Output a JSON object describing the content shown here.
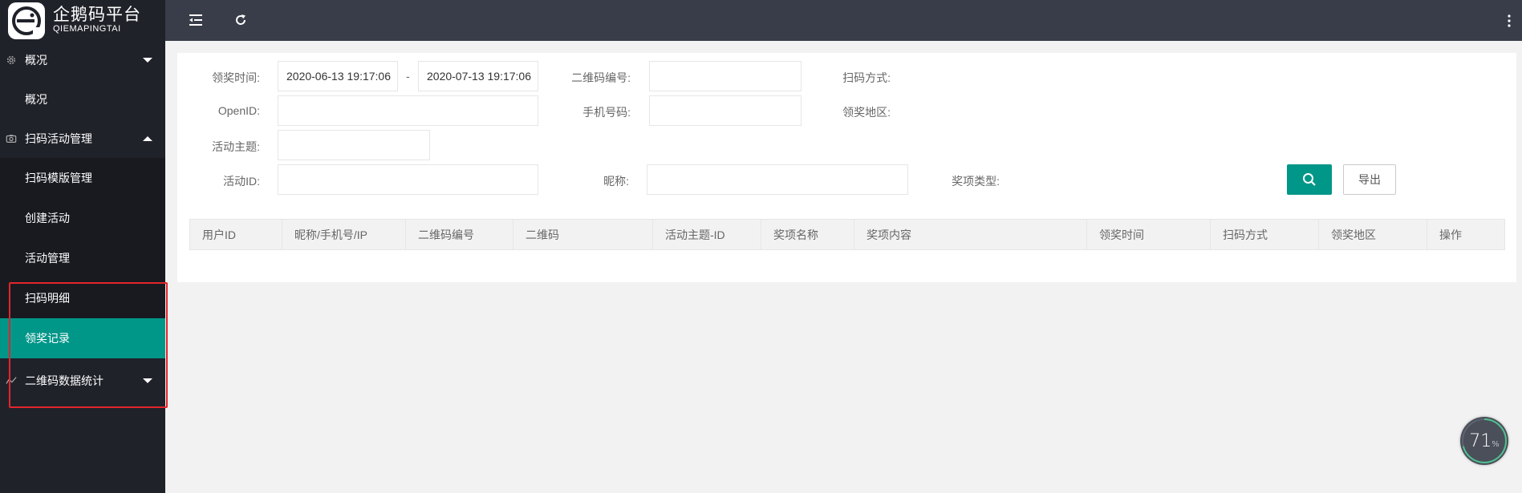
{
  "brand": {
    "name_cn": "企鹅码平台",
    "name_en": "QIEMAPINGTAI"
  },
  "sidebar": {
    "groups": [
      {
        "label": "概况",
        "icon": "gear-icon",
        "expanded": true
      },
      {
        "label": "扫码活动管理",
        "icon": "camera-icon",
        "expanded": true
      },
      {
        "label": "二维码数据统计",
        "icon": "chart-icon",
        "expanded": false
      }
    ],
    "items": [
      {
        "label": "概况"
      },
      {
        "label": "扫码模版管理"
      },
      {
        "label": "创建活动"
      },
      {
        "label": "活动管理"
      },
      {
        "label": "扫码明细"
      },
      {
        "label": "领奖记录",
        "active": true
      }
    ]
  },
  "topbar": {
    "menu_icon": "menu-fold-icon",
    "refresh_icon": "refresh-icon",
    "more_icon": "more-vertical-icon"
  },
  "filters": {
    "award_time_label": "领奖时间:",
    "award_time_start": "2020-06-13 19:17:06",
    "award_time_sep": "-",
    "award_time_end": "2020-07-13 19:17:06",
    "qrcode_no_label": "二维码编号:",
    "qrcode_no_value": "",
    "scan_mode_label": "扫码方式:",
    "openid_label": "OpenID:",
    "openid_value": "",
    "phone_label": "手机号码:",
    "phone_value": "",
    "award_region_label": "领奖地区:",
    "theme_label": "活动主题:",
    "theme_value": "",
    "activity_id_label": "活动ID:",
    "activity_id_value": "",
    "nickname_label": "昵称:",
    "nickname_value": "",
    "prize_type_label": "奖项类型:",
    "search_icon": "search-icon",
    "export_label": "导出"
  },
  "table": {
    "columns": [
      "用户ID",
      "昵称/手机号/IP",
      "二维码编号",
      "二维码",
      "活动主题-ID",
      "奖项名称",
      "奖项内容",
      "领奖时间",
      "扫码方式",
      "领奖地区",
      "操作"
    ],
    "rows": []
  },
  "progress_widget": {
    "value": "71",
    "unit": "%",
    "fraction": 0.71
  },
  "colors": {
    "accent": "#009688",
    "sidebar_bg": "#20222a",
    "topbar_bg": "#393d49",
    "highlight": "#e4252b"
  }
}
